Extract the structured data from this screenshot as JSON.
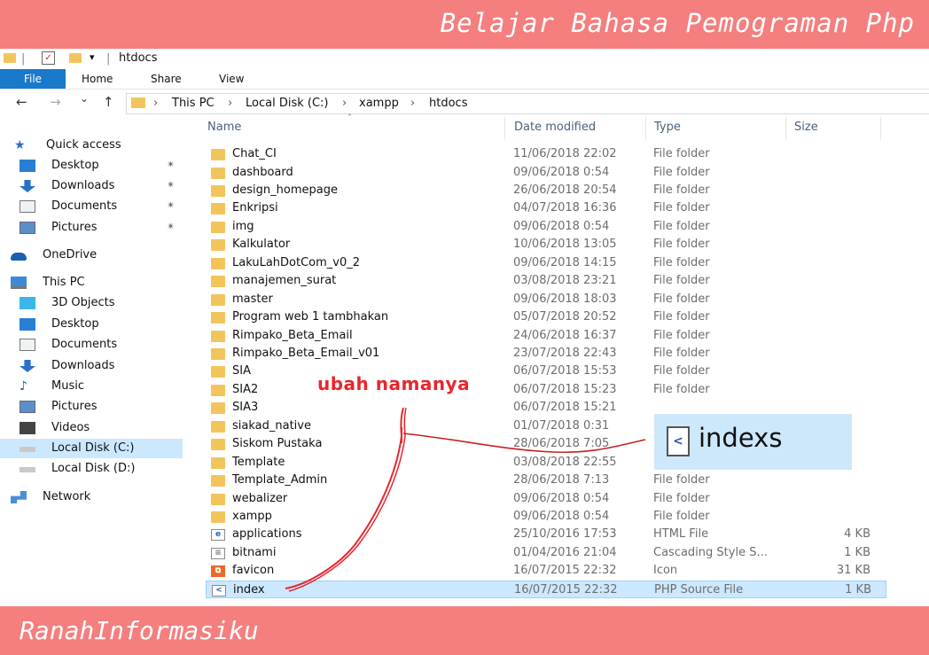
{
  "banner": {
    "top_text": "Belajar Bahasa Pemograman Php",
    "bottom_text": "RanahInformasiku",
    "color": "#f47f7e"
  },
  "titlebar": {
    "title": "htdocs",
    "dropdown": "▾",
    "check": "✓"
  },
  "ribbon": {
    "tabs": [
      "File",
      "Home",
      "Share",
      "View"
    ],
    "accent": "#1979ca"
  },
  "address": {
    "back": "←",
    "forward": "→",
    "recent": "⌄",
    "up": "↑",
    "sep": "›",
    "crumbs": [
      "This PC",
      "Local Disk (C:)",
      "xampp",
      "htdocs"
    ]
  },
  "nav": {
    "pin": "✴",
    "items": [
      {
        "label": "Quick access",
        "icon": "star-icon"
      },
      {
        "label": "Desktop",
        "icon": "desktop-icon"
      },
      {
        "label": "Downloads",
        "icon": "download-icon"
      },
      {
        "label": "Documents",
        "icon": "documents-icon"
      },
      {
        "label": "Pictures",
        "icon": "pictures-icon"
      },
      {
        "label": "OneDrive",
        "icon": "cloud-icon"
      },
      {
        "label": "This PC",
        "icon": "computer-icon"
      },
      {
        "label": "3D Objects",
        "icon": "cube-icon"
      },
      {
        "label": "Desktop",
        "icon": "desktop-icon"
      },
      {
        "label": "Documents",
        "icon": "documents-icon"
      },
      {
        "label": "Downloads",
        "icon": "download-icon"
      },
      {
        "label": "Music",
        "icon": "music-icon"
      },
      {
        "label": "Pictures",
        "icon": "pictures-icon"
      },
      {
        "label": "Videos",
        "icon": "video-icon"
      },
      {
        "label": "Local Disk (C:)",
        "icon": "drive-icon"
      },
      {
        "label": "Local Disk (D:)",
        "icon": "drive-icon"
      },
      {
        "label": "Network",
        "icon": "network-icon"
      }
    ]
  },
  "columns": {
    "name": "Name",
    "date": "Date modified",
    "type": "Type",
    "size": "Size",
    "sort": "˄"
  },
  "files": [
    {
      "name": "Chat_CI",
      "date": "11/06/2018 22:02",
      "type": "File folder",
      "size": "",
      "icon": "folder"
    },
    {
      "name": "dashboard",
      "date": "09/06/2018 0:54",
      "type": "File folder",
      "size": "",
      "icon": "folder"
    },
    {
      "name": "design_homepage",
      "date": "26/06/2018 20:54",
      "type": "File folder",
      "size": "",
      "icon": "folder"
    },
    {
      "name": "Enkripsi",
      "date": "04/07/2018 16:36",
      "type": "File folder",
      "size": "",
      "icon": "folder"
    },
    {
      "name": "img",
      "date": "09/06/2018 0:54",
      "type": "File folder",
      "size": "",
      "icon": "folder"
    },
    {
      "name": "Kalkulator",
      "date": "10/06/2018 13:05",
      "type": "File folder",
      "size": "",
      "icon": "folder"
    },
    {
      "name": "LakuLahDotCom_v0_2",
      "date": "09/06/2018 14:15",
      "type": "File folder",
      "size": "",
      "icon": "folder"
    },
    {
      "name": "manajemen_surat",
      "date": "03/08/2018 23:21",
      "type": "File folder",
      "size": "",
      "icon": "folder"
    },
    {
      "name": "master",
      "date": "09/06/2018 18:03",
      "type": "File folder",
      "size": "",
      "icon": "folder"
    },
    {
      "name": "Program web 1 tambhakan",
      "date": "05/07/2018 20:52",
      "type": "File folder",
      "size": "",
      "icon": "folder"
    },
    {
      "name": "Rimpako_Beta_Email",
      "date": "24/06/2018 16:37",
      "type": "File folder",
      "size": "",
      "icon": "folder"
    },
    {
      "name": "Rimpako_Beta_Email_v01",
      "date": "23/07/2018 22:43",
      "type": "File folder",
      "size": "",
      "icon": "folder"
    },
    {
      "name": "SIA",
      "date": "06/07/2018 15:53",
      "type": "File folder",
      "size": "",
      "icon": "folder"
    },
    {
      "name": "SIA2",
      "date": "06/07/2018 15:23",
      "type": "File folder",
      "size": "",
      "icon": "folder"
    },
    {
      "name": "SIA3",
      "date": "06/07/2018 15:21",
      "type": "",
      "size": "",
      "icon": "folder"
    },
    {
      "name": "siakad_native",
      "date": "01/07/2018 0:31",
      "type": "",
      "size": "",
      "icon": "folder"
    },
    {
      "name": "Siskom Pustaka",
      "date": "28/06/2018 7:05",
      "type": "",
      "size": "",
      "icon": "folder"
    },
    {
      "name": "Template",
      "date": "03/08/2018 22:55",
      "type": "",
      "size": "",
      "icon": "folder"
    },
    {
      "name": "Template_Admin",
      "date": "28/06/2018 7:13",
      "type": "File folder",
      "size": "",
      "icon": "folder"
    },
    {
      "name": "webalizer",
      "date": "09/06/2018 0:54",
      "type": "File folder",
      "size": "",
      "icon": "folder"
    },
    {
      "name": "xampp",
      "date": "09/06/2018 0:54",
      "type": "File folder",
      "size": "",
      "icon": "folder"
    },
    {
      "name": "applications",
      "date": "25/10/2016 17:53",
      "type": "HTML File",
      "size": "4 KB",
      "icon": "html"
    },
    {
      "name": "bitnami",
      "date": "01/04/2016 21:04",
      "type": "Cascading Style S...",
      "size": "1 KB",
      "icon": "css"
    },
    {
      "name": "favicon",
      "date": "16/07/2015 22:32",
      "type": "Icon",
      "size": "31 KB",
      "icon": "ico"
    },
    {
      "name": "index",
      "date": "16/07/2015 22:32",
      "type": "PHP Source File",
      "size": "1 KB",
      "icon": "php",
      "selected": true
    }
  ],
  "annotation": {
    "label": "ubah namanya",
    "rename_to": "indexs",
    "color": "#e8262d"
  }
}
